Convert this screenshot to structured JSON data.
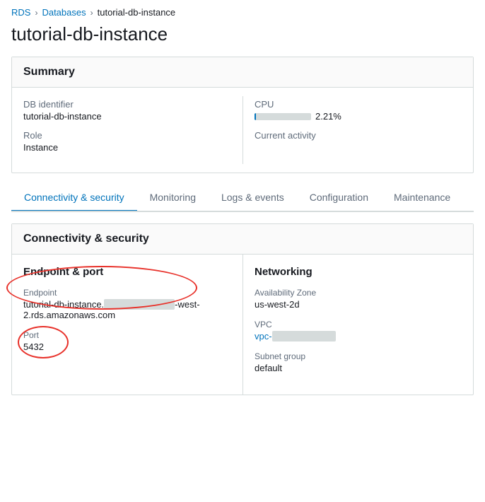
{
  "breadcrumb": {
    "items": [
      {
        "label": "RDS",
        "type": "link"
      },
      {
        "label": "Databases",
        "type": "link"
      },
      {
        "label": "tutorial-db-instance",
        "type": "current"
      }
    ],
    "separators": [
      ">",
      ">"
    ]
  },
  "page": {
    "title": "tutorial-db-instance"
  },
  "summary": {
    "header": "Summary",
    "left": {
      "db_identifier_label": "DB identifier",
      "db_identifier_value": "tutorial-db-instance",
      "role_label": "Role",
      "role_value": "Instance"
    },
    "right": {
      "cpu_label": "CPU",
      "cpu_percent": "2.21%",
      "cpu_fill_width": "2.21",
      "current_activity_label": "Current activity",
      "current_activity_value": ""
    }
  },
  "tabs": {
    "items": [
      {
        "label": "Connectivity & security",
        "active": true
      },
      {
        "label": "Monitoring",
        "active": false
      },
      {
        "label": "Logs & events",
        "active": false
      },
      {
        "label": "Configuration",
        "active": false
      },
      {
        "label": "Maintenance",
        "active": false
      }
    ]
  },
  "connectivity": {
    "header": "Connectivity & security",
    "endpoint_port": {
      "title": "Endpoint & port",
      "endpoint_label": "Endpoint",
      "endpoint_value": "tutorial-db-instance.",
      "endpoint_middle": "xxxxxxxxxxxxxxxxxx",
      "endpoint_suffix": "-west-2.rds.amazonaws.com",
      "port_label": "Port",
      "port_value": "5432"
    },
    "networking": {
      "title": "Networking",
      "az_label": "Availability Zone",
      "az_value": "us-west-2d",
      "vpc_label": "VPC",
      "vpc_value": "vpc-",
      "vpc_blurred": "xxxxxxxxxxxx",
      "subnet_label": "Subnet group",
      "subnet_value": "default"
    }
  }
}
